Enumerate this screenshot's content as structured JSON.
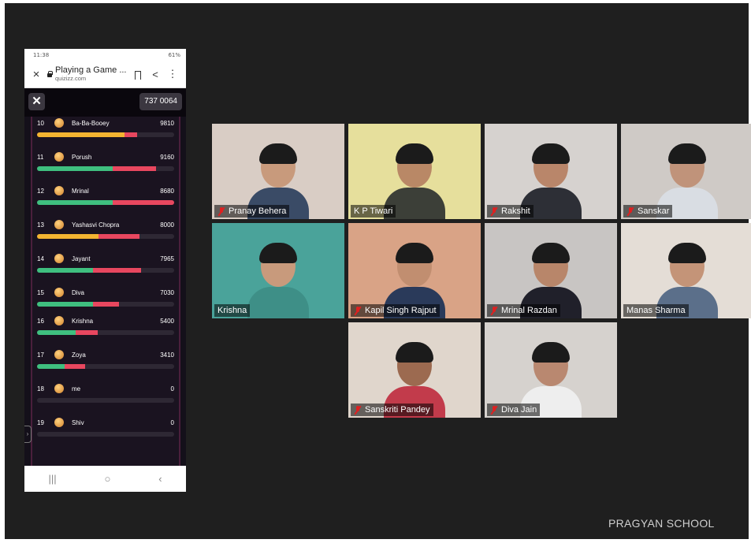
{
  "phone": {
    "status_time": "11:38",
    "status_right": "61%",
    "tab_title": "Playing a Game ...",
    "tab_url": "quizizz.com",
    "game_code": "737 0064",
    "close_glyph": "✕"
  },
  "leaderboard": [
    {
      "rank": "10",
      "name": "Ba-Ba-Booey",
      "score": "9810",
      "green": 0.0,
      "yellow": 0.64,
      "red": 0.09
    },
    {
      "rank": "11",
      "name": "Porush",
      "score": "9160",
      "green": 0.55,
      "yellow": 0.0,
      "red": 0.32
    },
    {
      "rank": "12",
      "name": "Mrinal",
      "score": "8680",
      "green": 0.55,
      "yellow": 0.0,
      "red": 0.45
    },
    {
      "rank": "13",
      "name": "Yashasvi Chopra",
      "score": "8000",
      "green": 0.0,
      "yellow": 0.45,
      "red": 0.3
    },
    {
      "rank": "14",
      "name": "Jayant",
      "score": "7965",
      "green": 0.41,
      "yellow": 0.0,
      "red": 0.35
    },
    {
      "rank": "15",
      "name": "Diva",
      "score": "7030",
      "green": 0.41,
      "yellow": 0.0,
      "red": 0.19
    },
    {
      "rank": "16",
      "name": "Krishna",
      "score": "5400",
      "green": 0.28,
      "yellow": 0.0,
      "red": 0.16
    },
    {
      "rank": "17",
      "name": "Zoya",
      "score": "3410",
      "green": 0.2,
      "yellow": 0.0,
      "red": 0.15
    },
    {
      "rank": "18",
      "name": "me",
      "score": "0",
      "green": 0.0,
      "yellow": 0.0,
      "red": 0.0
    },
    {
      "rank": "19",
      "name": "Shiv",
      "score": "0",
      "green": 0.0,
      "yellow": 0.0,
      "red": 0.0
    }
  ],
  "participants": [
    {
      "name": "Pranay Behera",
      "muted": true,
      "bg": "#d9cdc5",
      "body": "#3a4b66",
      "skin": "#c89a7c"
    },
    {
      "name": "K P Tiwari",
      "muted": false,
      "bg": "#e6df9c",
      "body": "#3c3f38",
      "skin": "#b98866"
    },
    {
      "name": "Rakshit",
      "muted": true,
      "bg": "#d6d2cf",
      "body": "#2d2f36",
      "skin": "#b9866a"
    },
    {
      "name": "Sanskar",
      "muted": true,
      "bg": "#cfcac6",
      "body": "#d9dde3",
      "skin": "#c0937a"
    },
    {
      "name": "Krishna",
      "muted": false,
      "bg": "#4aa39a",
      "body": "#3e8f87",
      "skin": "#c89a7c"
    },
    {
      "name": "Kapil Singh Rajput",
      "muted": true,
      "bg": "#d9a386",
      "body": "#2a3a5a",
      "skin": "#c18e70"
    },
    {
      "name": "Mrinal Razdan",
      "muted": true,
      "bg": "#c8c5c3",
      "body": "#20202a",
      "skin": "#b8866a"
    },
    {
      "name": "Manas Sharma",
      "muted": false,
      "bg": "#e4ddd6",
      "body": "#5b6f8a",
      "skin": "#c49478"
    },
    {
      "name": "Sanskriti Pandey",
      "muted": true,
      "bg": "#e0d6cc",
      "body": "#c23b4b",
      "skin": "#9c6a50"
    },
    {
      "name": "Diva Jain",
      "muted": true,
      "bg": "#d6d2ce",
      "body": "#eeeeee",
      "skin": "#b98870"
    }
  ],
  "watermark": "PRAGYAN SCHOOL",
  "colors": {
    "green": "#3fbf7f",
    "yellow": "#f3b431",
    "red": "#e8475f",
    "active_speaker": "#d8e05a"
  }
}
